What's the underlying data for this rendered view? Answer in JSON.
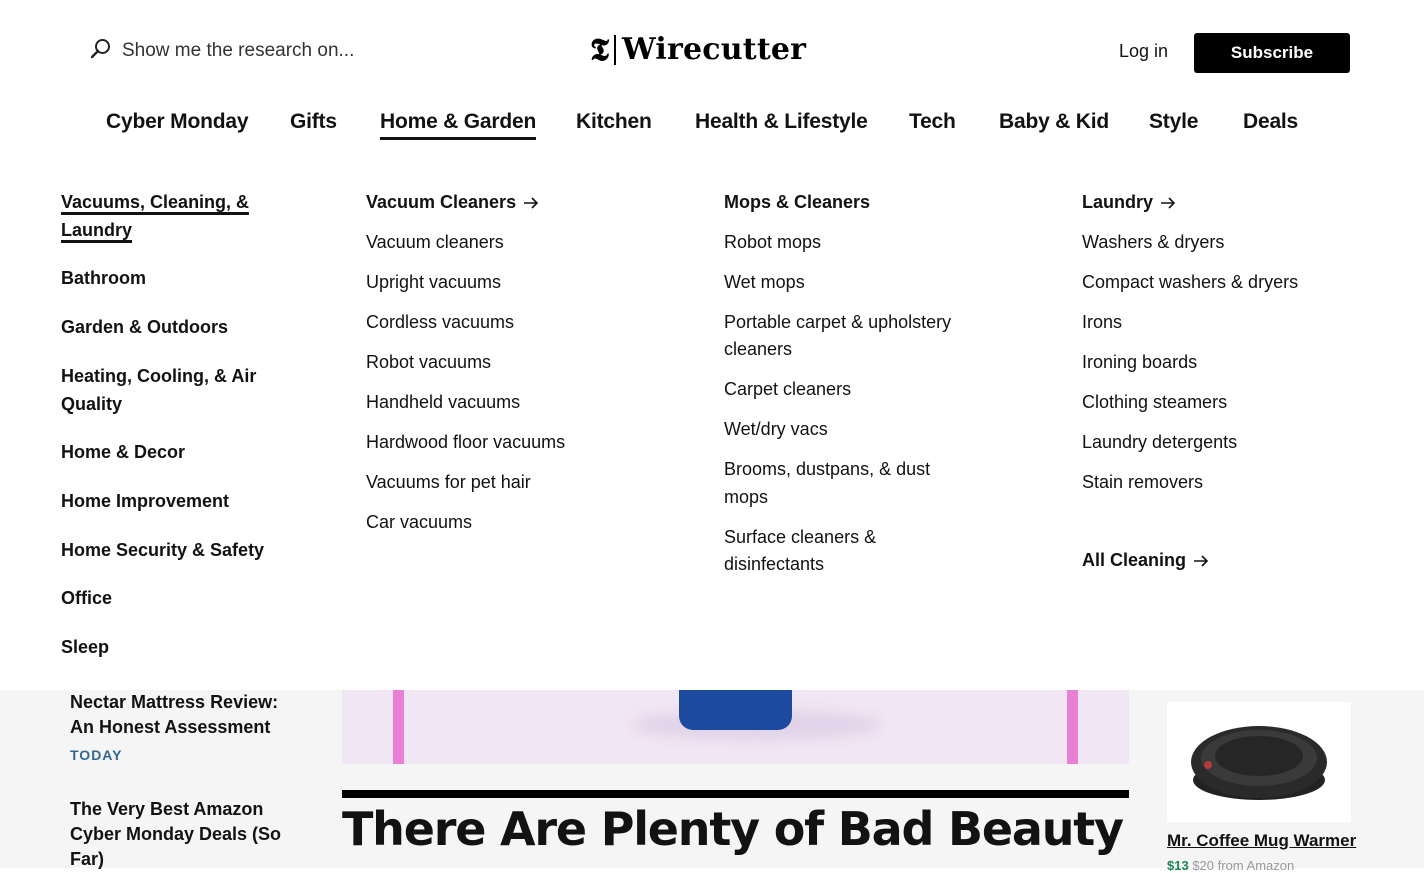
{
  "header": {
    "search_placeholder": "Show me the research on...",
    "brand_mark": "𝕿",
    "brand_name": "Wirecutter",
    "login_label": "Log in",
    "subscribe_label": "Subscribe"
  },
  "nav": {
    "items": [
      {
        "label": "Cyber Monday"
      },
      {
        "label": "Gifts"
      },
      {
        "label": "Home & Garden",
        "active": true
      },
      {
        "label": "Kitchen"
      },
      {
        "label": "Health & Lifestyle"
      },
      {
        "label": "Tech"
      },
      {
        "label": "Baby & Kid"
      },
      {
        "label": "Style"
      },
      {
        "label": "Deals"
      }
    ]
  },
  "dropdown": {
    "categories": [
      {
        "label": "Vacuums, Cleaning, & Laundry",
        "active": true
      },
      {
        "label": "Bathroom"
      },
      {
        "label": "Garden & Outdoors"
      },
      {
        "label": "Heating, Cooling, & Air Quality"
      },
      {
        "label": "Home & Decor"
      },
      {
        "label": "Home Improvement"
      },
      {
        "label": "Home Security & Safety"
      },
      {
        "label": "Office"
      },
      {
        "label": "Sleep"
      }
    ],
    "columns": [
      {
        "heading": "Vacuum Cleaners",
        "items": [
          "Vacuum cleaners",
          "Upright vacuums",
          "Cordless vacuums",
          "Robot vacuums",
          "Handheld vacuums",
          "Hardwood floor vacuums",
          "Vacuums for pet hair",
          "Car vacuums"
        ]
      },
      {
        "heading": "Mops & Cleaners",
        "items": [
          "Robot mops",
          "Wet mops",
          "Portable carpet & upholstery cleaners",
          "Carpet cleaners",
          "Wet/dry vacs",
          "Brooms, dustpans, & dust mops",
          "Surface cleaners & disinfectants"
        ]
      },
      {
        "heading": "Laundry",
        "items": [
          "Washers & dryers",
          "Compact washers & dryers",
          "Irons",
          "Ironing boards",
          "Clothing steamers",
          "Laundry detergents",
          "Stain removers"
        ]
      }
    ],
    "all_link": "All Cleaning"
  },
  "page": {
    "side_stories": [
      {
        "title": "Nectar Mattress Review: An Honest Assessment",
        "tag": "TODAY"
      },
      {
        "title": "The Very Best Amazon Cyber Monday Deals (So Far)"
      }
    ],
    "headline": "There Are Plenty of Bad Beauty",
    "product": {
      "name": "Mr. Coffee Mug Warmer",
      "price": "$13",
      "was_price": "$20 from Amazon"
    }
  },
  "colors": {
    "text": "#121212",
    "subscribe_bg": "#000000",
    "tag": "#326891",
    "price": "#1a8754",
    "page_bg": "#f5f5f5"
  },
  "icons": {
    "search": "search-icon",
    "arrow": "arrow-right-icon"
  }
}
